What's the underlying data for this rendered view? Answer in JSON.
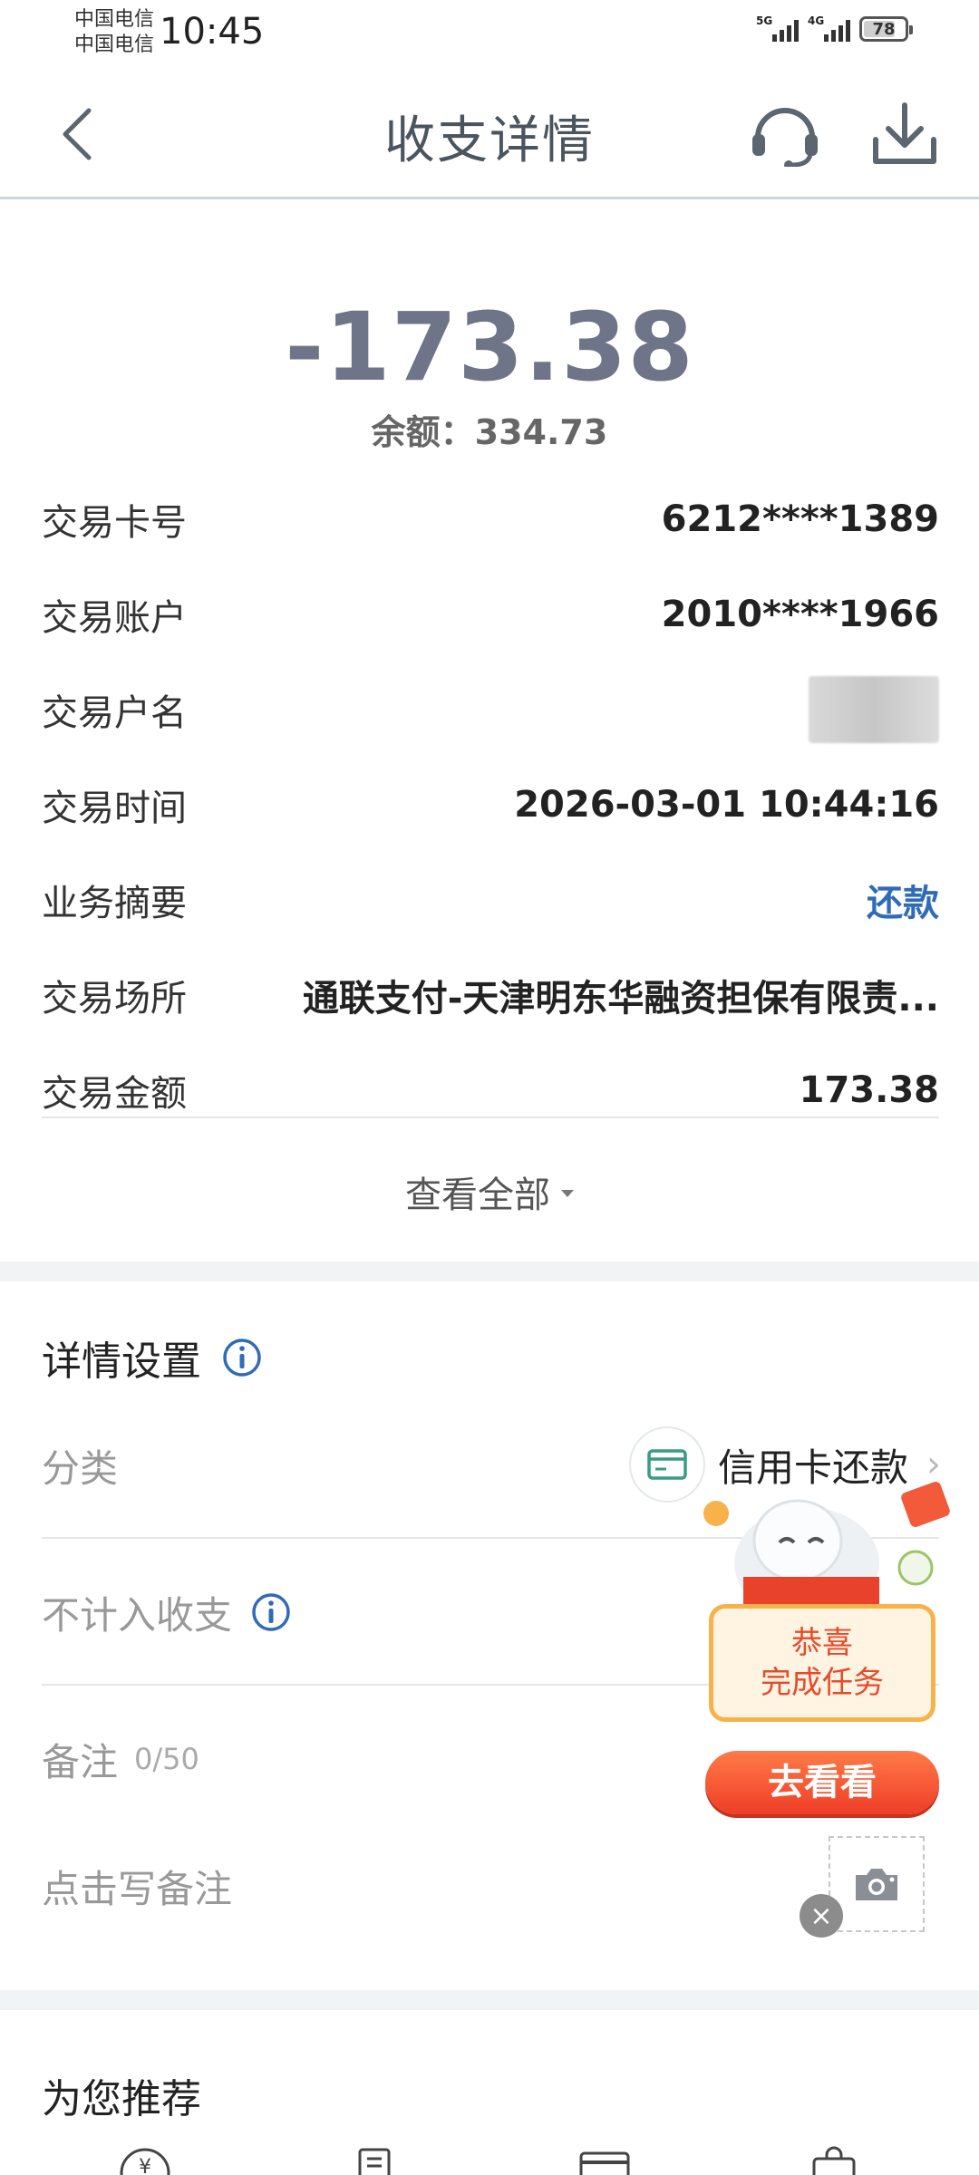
{
  "status_bar": {
    "carrier_1": "中国电信",
    "carrier_2": "中国电信",
    "time": "10:45",
    "network_1": "5G",
    "network_2": "4G",
    "battery": "78",
    "battery_level_percent": 78
  },
  "header": {
    "title": "收支详情",
    "back_icon": "chevron-left-icon",
    "support_icon": "headset-icon",
    "download_icon": "download-icon"
  },
  "summary": {
    "amount": "-173.38",
    "balance": "余额：334.73"
  },
  "details": [
    {
      "label": "交易卡号",
      "value": "6212****1389"
    },
    {
      "label": "交易账户",
      "value": "2010****1966"
    },
    {
      "label": "交易户名",
      "value": ""
    },
    {
      "label": "交易时间",
      "value": "2026-03-01 10:44:16"
    },
    {
      "label": "业务摘要",
      "value": "还款"
    },
    {
      "label": "交易场所",
      "value": "通联支付-天津明东华融资担保有限责..."
    },
    {
      "label": "交易金额",
      "value": "173.38"
    }
  ],
  "view_all": "查看全部",
  "settings": {
    "title": "详情设置",
    "category_label": "分类",
    "category_value": "信用卡还款",
    "exclude_label": "不计入收支",
    "note_label": "备注",
    "note_count": "0/50",
    "note_placeholder": "点击写备注"
  },
  "promo": {
    "line_1": "恭喜",
    "line_2": "完成任务",
    "button": "去看看"
  },
  "recommend": {
    "title": "为您推荐"
  },
  "colors": {
    "link_blue": "#2f6bb7",
    "amount_gray": "#6f7588",
    "promo_orange": "#ef3d27"
  }
}
